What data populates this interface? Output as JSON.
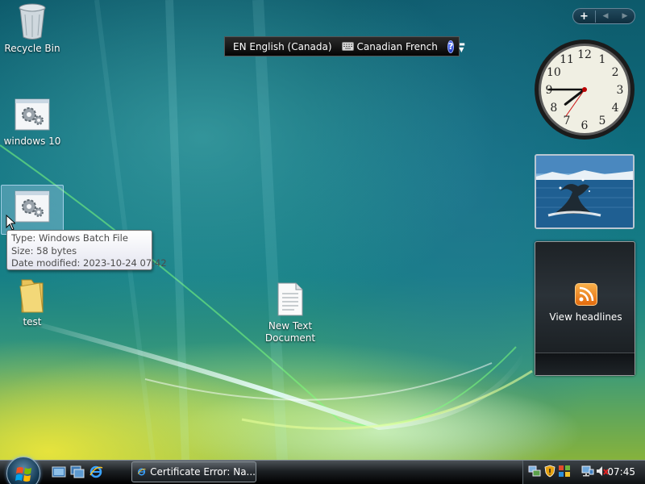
{
  "desktop": {
    "icons": [
      {
        "label": "Recycle Bin",
        "icon": "recycle-bin-icon"
      },
      {
        "label": "windows 10",
        "icon": "batch-file-gear-icon"
      },
      {
        "label": "",
        "icon": "batch-file-gear-icon",
        "selected": true
      },
      {
        "label": "test",
        "icon": "folder-icon"
      },
      {
        "label": "New Text Document",
        "icon": "text-document-icon"
      }
    ],
    "tooltip": {
      "type": "Type: Windows Batch File",
      "size": "Size: 58 bytes",
      "modified": "Date modified: 2023-10-24 07:42"
    }
  },
  "language_bar": {
    "language": "EN English (Canada)",
    "keyboard": "Canadian French",
    "help": "?",
    "keyboard_icon": "keyboard-icon"
  },
  "sidebar": {
    "add_label": "+",
    "prev_label": "◀",
    "next_label": "▶",
    "clock": {
      "hour": 7,
      "minute": 45,
      "numerals": [
        "12",
        "1",
        "2",
        "3",
        "4",
        "5",
        "6",
        "7",
        "8",
        "9",
        "10",
        "11"
      ]
    },
    "slideshow": {
      "subject": "whale-tail-photo"
    },
    "feed_headlines": {
      "label": "View headlines",
      "icon": "rss-icon"
    }
  },
  "taskbar": {
    "start_icon": "windows-start-orb",
    "quick_launch": [
      "show-desktop-icon",
      "switch-windows-icon",
      "internet-explorer-icon"
    ],
    "tasks": [
      {
        "label": "Certificate Error: Na...",
        "icon": "internet-explorer-icon"
      }
    ],
    "tray_icons": [
      "network-sync-icon",
      "security-warning-icon",
      "windows-update-icon",
      "network-icon",
      "volume-muted-icon"
    ],
    "time": "07:45"
  },
  "colors": {
    "taskbar": "#1b1f22",
    "tooltip_text": "#4c4c4c",
    "feed_orange": "#e36a0d"
  }
}
